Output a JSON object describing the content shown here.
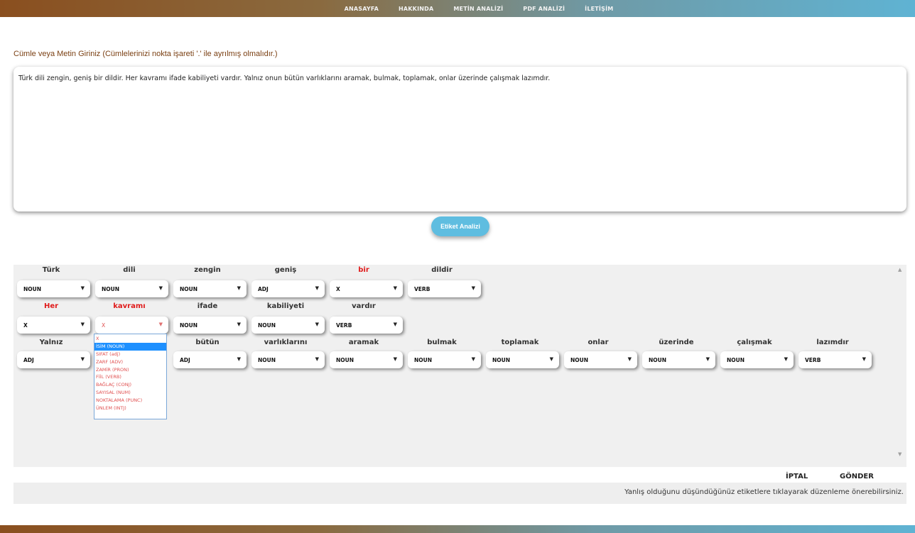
{
  "nav": {
    "items": [
      "ANASAYFA",
      "HAKKINDA",
      "METİN ANALİZİ",
      "PDF ANALİZİ",
      "İLETİŞİM"
    ]
  },
  "form": {
    "prompt": "Cümle veya Metin Giriniz (Cümlelerinizi nokta işareti '.' ile ayrılmış olmalıdır.)",
    "text": "Türk dili zengin, geniş bir dildir. Her kavramı ifade kabiliyeti vardır. Yalnız onun bütün varlıklarını aramak, bulmak, toplamak, onlar üzerinde çalışmak lazımdır.",
    "analyze_label": "Etiket Analizi"
  },
  "tokens": {
    "row1": [
      {
        "word": "Türk",
        "tag": "NOUN"
      },
      {
        "word": "dili",
        "tag": "NOUN"
      },
      {
        "word": "zengin",
        "tag": "NOUN"
      },
      {
        "word": "geniş",
        "tag": "ADJ"
      },
      {
        "word": "bir",
        "tag": "X"
      },
      {
        "word": "dildir",
        "tag": "VERB"
      }
    ],
    "row2": [
      {
        "word": "Her",
        "tag": "X"
      },
      {
        "word": "kavramı",
        "tag": "X"
      },
      {
        "word": "ifade",
        "tag": "NOUN"
      },
      {
        "word": "kabiliyeti",
        "tag": "NOUN"
      },
      {
        "word": "vardır",
        "tag": "VERB"
      }
    ],
    "row3": [
      {
        "word": "Yalnız",
        "tag": "ADJ"
      },
      {
        "word": "bütün",
        "tag": "ADJ"
      },
      {
        "word": "varlıklarını",
        "tag": "NOUN"
      },
      {
        "word": "aramak",
        "tag": "NOUN"
      },
      {
        "word": "bulmak",
        "tag": "NOUN"
      },
      {
        "word": "toplamak",
        "tag": "NOUN"
      },
      {
        "word": "onlar",
        "tag": "NOUN"
      },
      {
        "word": "üzerinde",
        "tag": "NOUN"
      },
      {
        "word": "çalışmak",
        "tag": "NOUN"
      },
      {
        "word": "lazımdır",
        "tag": "VERB"
      }
    ]
  },
  "dropdown_options": [
    "X",
    "İSİM (NOUN)",
    "SIFAT (adj)",
    "ZARF (ADV)",
    "ZAMİR (PRON)",
    "FİİL (VERB)",
    "BAĞLAÇ (CONJ)",
    "SAYISAL (NUM)",
    "NOKTALAMA (PUNC)",
    "ÜNLEM (INTJ)"
  ],
  "actions": {
    "cancel_label": "İPTAL",
    "submit_label": "GÖNDER"
  },
  "hint": "Yanlış olduğunu düşündüğünüz etiketlere tıklayarak düzenleme önerebilirsiniz.",
  "colors": {
    "highlight_word": "#e01b1b",
    "analyze_button": "#5fbde0",
    "dropdown_selected": "#1e90ff"
  }
}
